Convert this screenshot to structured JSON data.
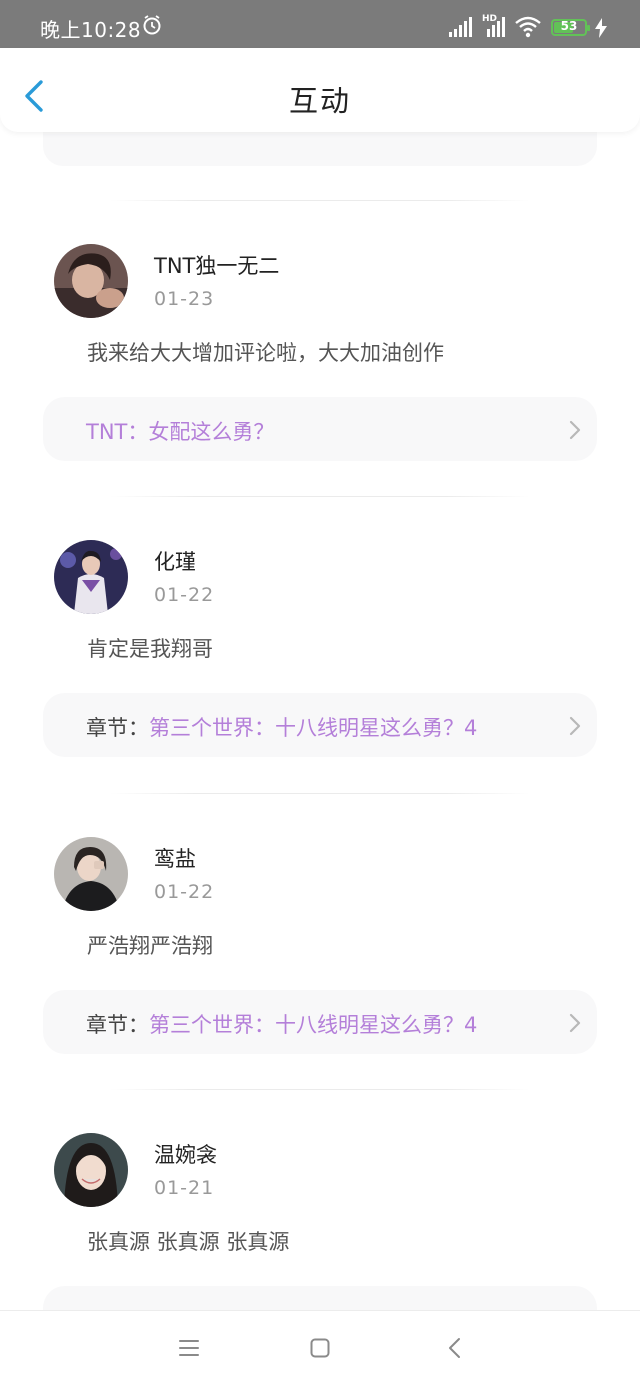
{
  "status_bar": {
    "time": "晚上10:28",
    "hd_label": "HD",
    "battery": "53"
  },
  "header": {
    "title": "互动"
  },
  "comments": [
    {
      "username": "TNT独一无二",
      "date": "01-23",
      "text": "我来给大大增加评论啦，大大加油创作",
      "ref_label": "",
      "ref_title": "TNT：女配这么勇？"
    },
    {
      "username": "化瑾",
      "date": "01-22",
      "text": "肯定是我翔哥",
      "ref_label": "章节：",
      "ref_title": "第三个世界：十八线明星这么勇？4"
    },
    {
      "username": "鸾盐",
      "date": "01-22",
      "text": "严浩翔严浩翔",
      "ref_label": "章节：",
      "ref_title": "第三个世界：十八线明星这么勇？4"
    },
    {
      "username": "温婉衾",
      "date": "01-21",
      "text": "张真源 张真源 张真源"
    }
  ],
  "colors": {
    "accent": "#2a9bd8",
    "link_purple": "#b47fd9",
    "battery_green": "#62c257"
  },
  "icons": {
    "back": "chevron-left-icon",
    "ref_arrow": "chevron-right-icon",
    "nav_menu": "menu-icon",
    "nav_home": "square-home-icon",
    "nav_back": "triangle-back-icon"
  }
}
